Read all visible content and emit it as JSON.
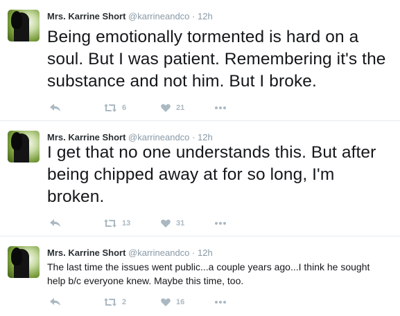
{
  "icons": {
    "reply": "reply-icon",
    "retweet": "retweet-icon",
    "like": "heart-icon",
    "more": "more-icon"
  },
  "colors": {
    "text": "#14171a",
    "muted": "#8899a6",
    "action": "#aab8c2",
    "divider": "#e6ecf0"
  },
  "tweets": [
    {
      "name": "Mrs. Karrine Short",
      "handle": "@karrineandco",
      "sep": "·",
      "time": "12h",
      "text": "Being emotionally tormented is hard on a soul. But I was patient. Remembering it's the substance and not him. But I broke.",
      "retweets": "6",
      "likes": "21"
    },
    {
      "name": "Mrs. Karrine Short",
      "handle": "@karrineandco",
      "sep": "·",
      "time": "12h",
      "text": "I get that no one understands this. But after being chipped away at for so long, I'm broken.",
      "retweets": "13",
      "likes": "31"
    },
    {
      "name": "Mrs. Karrine Short",
      "handle": "@karrineandco",
      "sep": "·",
      "time": "12h",
      "text": "The last time the issues went public...a couple years ago...I think he sought help b/c everyone knew. Maybe this time, too.",
      "retweets": "2",
      "likes": "16"
    }
  ]
}
